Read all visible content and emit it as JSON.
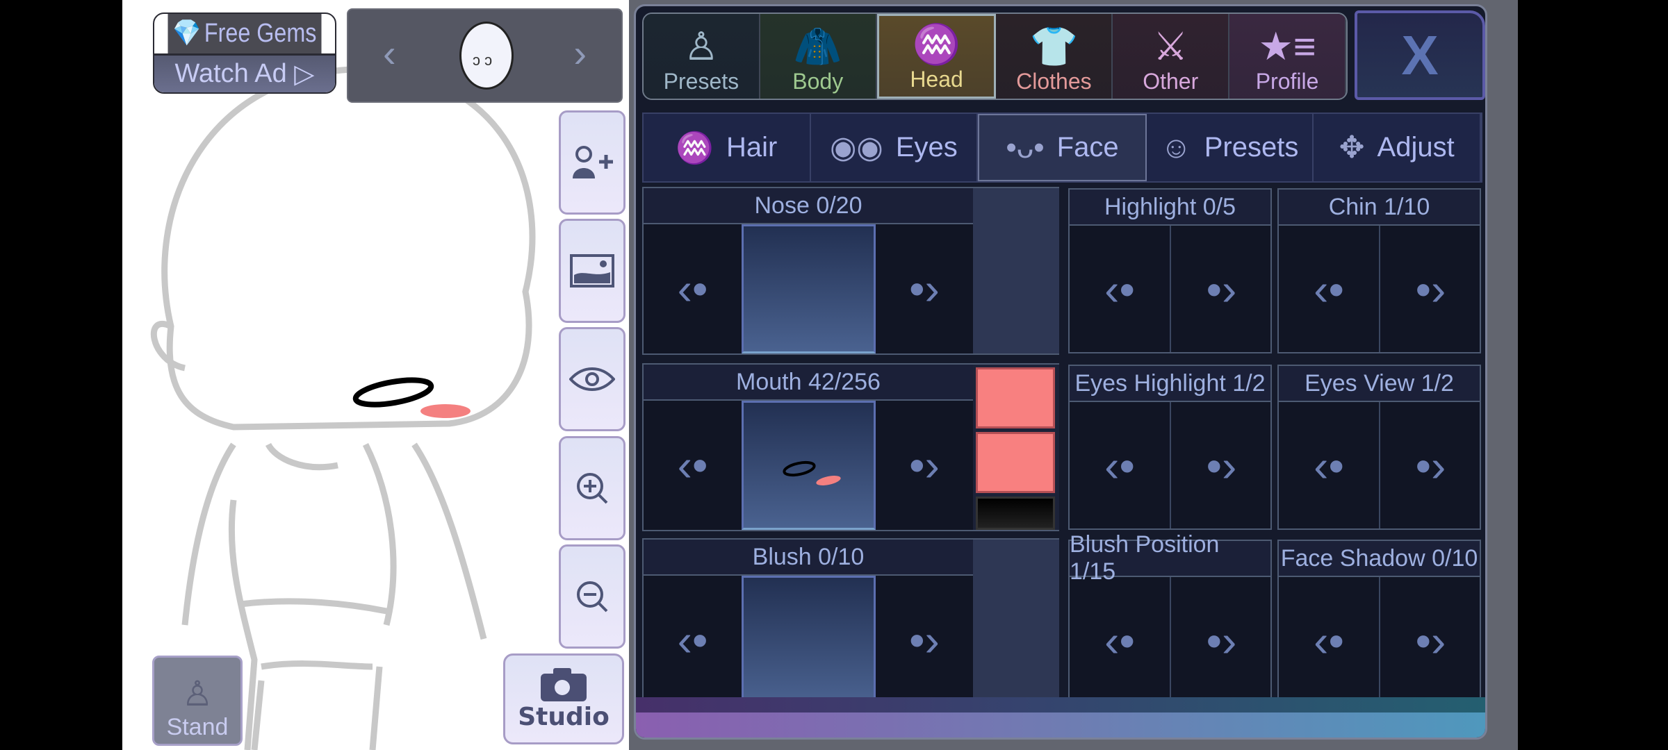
{
  "top_left": {
    "free_gems": "Free Gems",
    "watch_ad": "Watch Ad"
  },
  "face_selector": {
    "prev": "‹",
    "next": "›"
  },
  "tools": [
    {
      "name": "add-character-icon"
    },
    {
      "name": "background-icon"
    },
    {
      "name": "eye-icon"
    },
    {
      "name": "zoom-in-icon"
    },
    {
      "name": "zoom-out-icon"
    }
  ],
  "studio": "Studio",
  "stand": "Stand",
  "top_tabs": [
    {
      "label": "Presets",
      "color": "#9fb7c8",
      "bg": "#1c2630",
      "icon": "character-icon"
    },
    {
      "label": "Body",
      "color": "#9ec98f",
      "bg": "#25332a",
      "icon": "body-icon"
    },
    {
      "label": "Head",
      "color": "#e8d98f",
      "bg": "#5a4a2a",
      "icon": "hair-icon",
      "active": true
    },
    {
      "label": "Clothes",
      "color": "#e39a9a",
      "bg": "#2a2228",
      "icon": "shirt-icon"
    },
    {
      "label": "Other",
      "color": "#d8a8dc",
      "bg": "#30222f",
      "icon": "sword-cat-icon"
    },
    {
      "label": "Profile",
      "color": "#c8a8e6",
      "bg": "#3a2840",
      "icon": "star-list-icon"
    }
  ],
  "close_label": "X",
  "sub_tabs": [
    {
      "label": "Hair",
      "icon": "hair-icon",
      "glyph": "♒"
    },
    {
      "label": "Eyes",
      "icon": "eyes-icon",
      "glyph": "◉◉"
    },
    {
      "label": "Face",
      "icon": "face-icon",
      "glyph": "•ᴗ•",
      "active": true
    },
    {
      "label": "Presets",
      "icon": "face-preset-icon",
      "glyph": "☺"
    },
    {
      "label": "Adjust",
      "icon": "move-icon",
      "glyph": "✥"
    }
  ],
  "options": {
    "nose": "Nose 0/20",
    "mouth": "Mouth 42/256",
    "blush": "Blush 0/10",
    "highlight": "Highlight 0/5",
    "chin": "Chin 1/10",
    "eyes_highlight": "Eyes Highlight 1/2",
    "eyes_view": "Eyes View 1/2",
    "blush_position": "Blush Position 1/15",
    "face_shadow": "Face Shadow 0/10"
  },
  "mouth_colors": [
    "#f88080",
    "#f88080",
    "#000000"
  ],
  "accent": "#9eb0e0"
}
